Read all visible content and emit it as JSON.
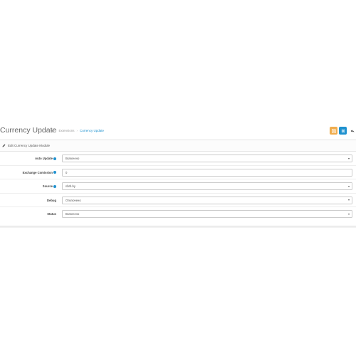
{
  "header": {
    "title": "Currency Update",
    "breadcrumb": [
      "Extensions",
      "Currency Update"
    ],
    "actions": {
      "save_icon": "save-icon",
      "cancel_icon": "reply-icon",
      "back_icon": "undo-icon"
    }
  },
  "panel": {
    "heading": "Edit Currency Update Module",
    "fields": [
      {
        "label": "Auto Update",
        "value": "Включено",
        "type": "select",
        "help": true
      },
      {
        "label": "Exchange Comission",
        "value": "0",
        "type": "input",
        "help": true
      },
      {
        "label": "Source",
        "value": "nbrb.by",
        "type": "select",
        "help": true
      },
      {
        "label": "Debug",
        "value": "Отключено",
        "type": "select",
        "help": false
      },
      {
        "label": "Status",
        "value": "Включено",
        "type": "select",
        "help": false
      }
    ]
  },
  "colors": {
    "accent": "#1e91cf",
    "warning": "#f0ad4e"
  }
}
